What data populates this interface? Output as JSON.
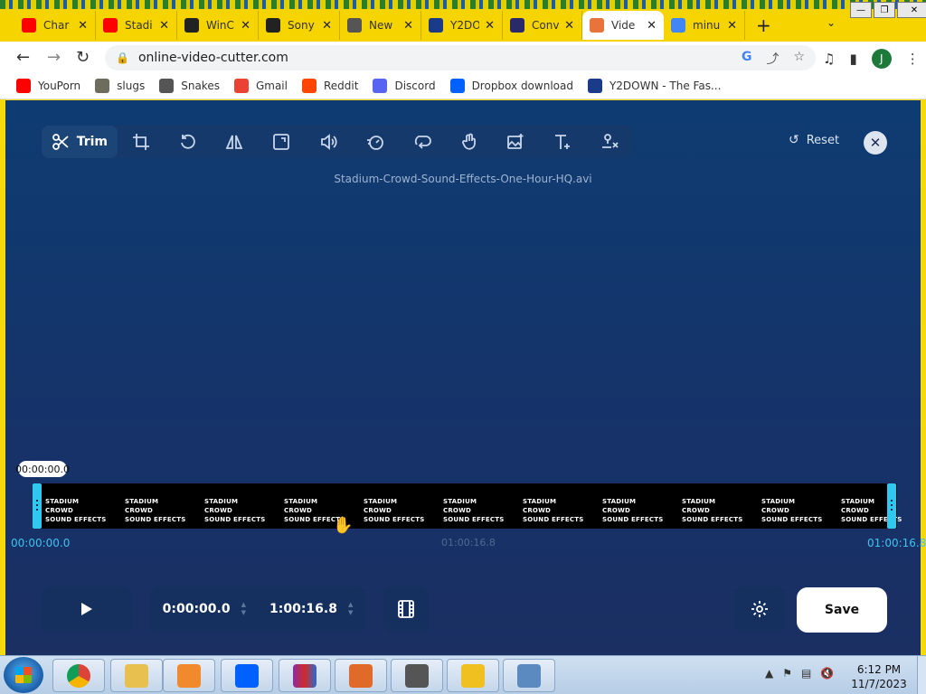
{
  "browser": {
    "tabs": [
      {
        "title": "Char",
        "favicon": "youtube-icon",
        "color": "#ff0000"
      },
      {
        "title": "Stadi",
        "favicon": "youtube-icon",
        "color": "#ff0000"
      },
      {
        "title": "WinC",
        "favicon": "gear-icon",
        "color": "#222222"
      },
      {
        "title": "Sony",
        "favicon": "museum-icon",
        "color": "#222222"
      },
      {
        "title": "New",
        "favicon": "chrome-icon",
        "color": "#555555"
      },
      {
        "title": "Y2DO",
        "favicon": "y2down-icon",
        "color": "#1a3a8a"
      },
      {
        "title": "Conv",
        "favicon": "convert-icon",
        "color": "#2a2a6a"
      },
      {
        "title": "Vide",
        "favicon": "video-cutter-icon",
        "color": "#e8743b",
        "active": true
      },
      {
        "title": "minu",
        "favicon": "google-icon",
        "color": "#4285f4"
      }
    ],
    "url": "online-video-cutter.com",
    "avatar_letter": "J",
    "bookmarks": [
      {
        "label": "YouPorn",
        "icon": "youtube-icon",
        "color": "#ff0000"
      },
      {
        "label": "slugs",
        "icon": "slug-icon",
        "color": "#6d6d5d"
      },
      {
        "label": "Snakes",
        "icon": "globe-icon",
        "color": "#555555"
      },
      {
        "label": "Gmail",
        "icon": "gmail-icon",
        "color": "#ea4335"
      },
      {
        "label": "Reddit",
        "icon": "reddit-icon",
        "color": "#ff4500"
      },
      {
        "label": "Discord",
        "icon": "discord-icon",
        "color": "#5865f2"
      },
      {
        "label": "Dropbox download",
        "icon": "dropbox-icon",
        "color": "#0061ff"
      },
      {
        "label": "Y2DOWN - The Fas...",
        "icon": "y2down-icon",
        "color": "#1a3a8a"
      }
    ]
  },
  "editor": {
    "trim_label": "Trim",
    "reset_label": "Reset",
    "filename": "Stadium-Crowd-Sound-Effects-One-Hour-HQ.avi",
    "timeline": {
      "playhead_time": "00:00:00.0",
      "start_time": "00:00:00.0",
      "mid_time": "01:00:16.8",
      "end_time": "01:00:16.8",
      "frame_text_line1": "STADIUM CROWD",
      "frame_text_line2": "SOUND EFFECTS"
    },
    "controls": {
      "start_value": "0:00:00.0",
      "end_value": "1:00:16.8",
      "save_label": "Save"
    },
    "accent_color": "#2fc8f0"
  },
  "taskbar": {
    "time": "6:12 PM",
    "date": "11/7/2023"
  }
}
